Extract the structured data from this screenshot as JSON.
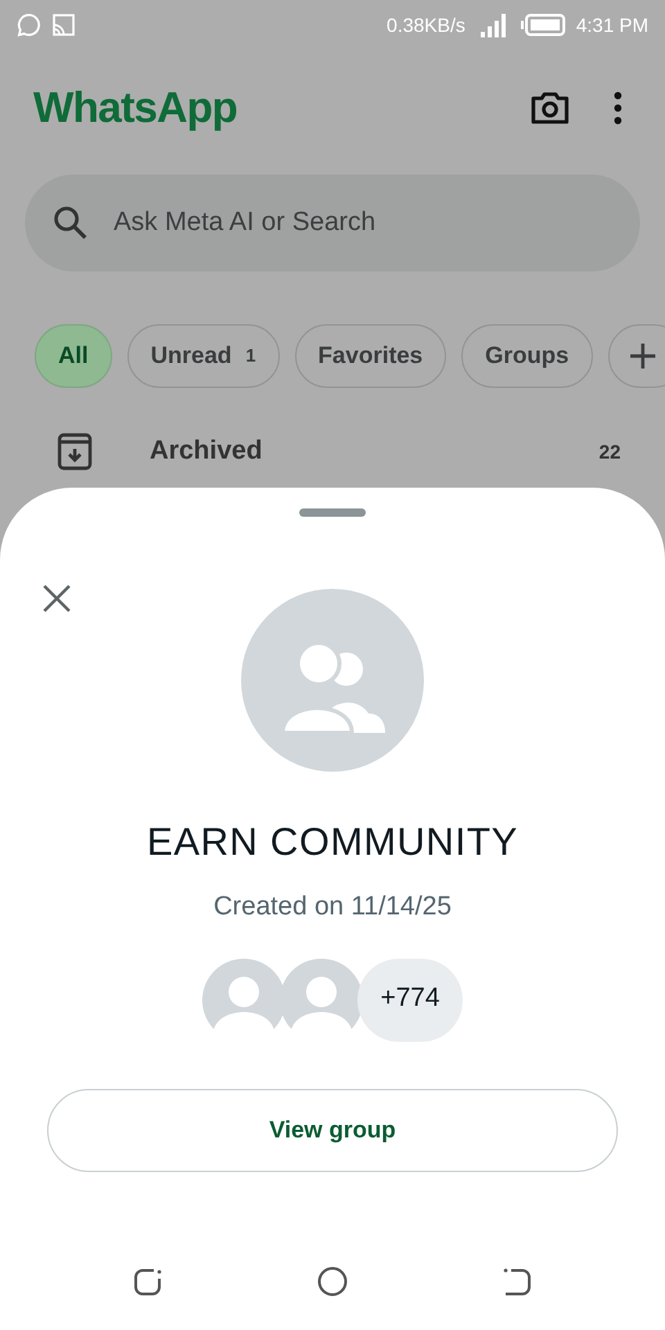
{
  "status_bar": {
    "speed": "0.38KB/s",
    "time": "4:31 PM"
  },
  "app_bar": {
    "title": "WhatsApp"
  },
  "search": {
    "placeholder": "Ask Meta AI or Search"
  },
  "filters": [
    {
      "label": "All",
      "selected": true
    },
    {
      "label": "Unread",
      "count": "1",
      "selected": false
    },
    {
      "label": "Favorites",
      "selected": false
    },
    {
      "label": "Groups",
      "selected": false
    }
  ],
  "archived": {
    "label": "Archived",
    "count": "22"
  },
  "sheet": {
    "title": "EARN COMMUNITY",
    "subtitle": "Created on 11/14/25",
    "member_count": "+774",
    "button": "View group"
  }
}
